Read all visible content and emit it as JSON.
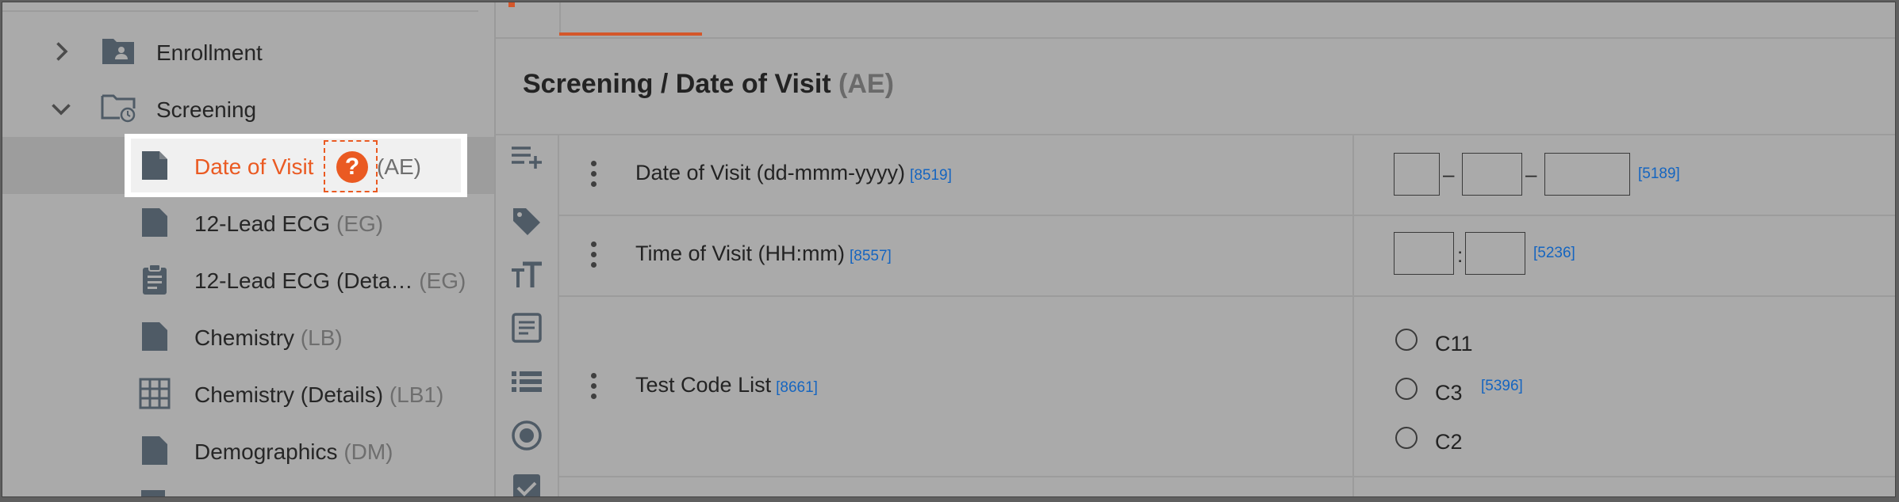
{
  "sidebar": {
    "folders": [
      {
        "label": "Enrollment",
        "expanded": false
      },
      {
        "label": "Screening",
        "expanded": true
      }
    ],
    "forms": [
      {
        "label": "Date of Visit",
        "abbr": "(AE)",
        "active": true,
        "icon": "document-icon"
      },
      {
        "label": "12-Lead ECG",
        "abbr": "(EG)",
        "icon": "document-icon"
      },
      {
        "label": "12-Lead ECG (Deta…",
        "abbr": "(EG)",
        "icon": "clipboard-icon"
      },
      {
        "label": "Chemistry",
        "abbr": "(LB)",
        "icon": "document-icon"
      },
      {
        "label": "Chemistry (Details)",
        "abbr": "(LB1)",
        "icon": "grid-icon"
      },
      {
        "label": "Demographics",
        "abbr": "(DM)",
        "icon": "document-icon"
      }
    ],
    "help_glyph": "?"
  },
  "header": {
    "title": "Screening / Date of Visit",
    "abbr": "(AE)"
  },
  "colors": {
    "accent": "#ea5a22",
    "code_link": "#1565c0"
  },
  "questions": [
    {
      "label": "Date of Visit (dd-mmm-yyyy)",
      "code": "[8519]",
      "field_code": "[5189]",
      "date_sep": "–"
    },
    {
      "label": "Time of Visit (HH:mm)",
      "code": "[8557]",
      "field_code": "[5236]",
      "time_sep": ":"
    },
    {
      "label": "Test Code List",
      "code": "[8661]",
      "field_code": "[5396]",
      "options": [
        "C11",
        "C3",
        "C2"
      ]
    }
  ]
}
